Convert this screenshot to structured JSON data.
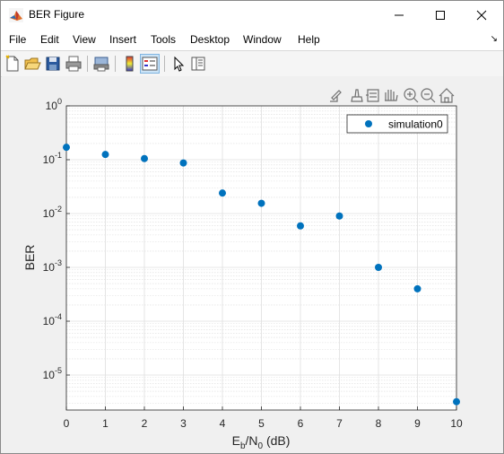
{
  "window": {
    "title": "BER Figure",
    "controls": {
      "minimize": "minimize",
      "maximize": "maximize",
      "close": "close"
    }
  },
  "menu": [
    "File",
    "Edit",
    "View",
    "Insert",
    "Tools",
    "Desktop",
    "Window",
    "Help"
  ],
  "toolbar": {
    "buttons": [
      "new-figure-icon",
      "open-file-icon",
      "save-icon",
      "print-icon",
      "print-preview-icon",
      "colorbar-icon",
      "legend-icon",
      "pointer-icon",
      "property-inspector-icon"
    ],
    "selected": "legend-icon"
  },
  "axes_toolbar": [
    "export-icon",
    "brush-icon",
    "datatip-icon",
    "pan-icon",
    "zoom-in-icon",
    "zoom-out-icon",
    "home-icon"
  ],
  "chart_data": {
    "type": "scatter",
    "xlabel": "E_b/N_0 (dB)",
    "ylabel": "BER",
    "x_ticks": [
      0,
      1,
      2,
      3,
      4,
      5,
      6,
      7,
      8,
      9,
      10
    ],
    "y_ticks": [
      0,
      -1,
      -2,
      -3,
      -4,
      -5
    ],
    "xlim": [
      0,
      10
    ],
    "ylim_log10": [
      -5.65,
      0
    ],
    "yscale": "log",
    "grid": "on (major and minor)",
    "legend_position": "top-right",
    "series": [
      {
        "name": "simulation0",
        "color": "#0072bd",
        "x": [
          0,
          1,
          2,
          3,
          4,
          5,
          6,
          7,
          8,
          9,
          10
        ],
        "y": [
          0.17,
          0.125,
          0.105,
          0.087,
          0.024,
          0.0155,
          0.0059,
          0.009,
          0.001,
          0.0004,
          3.2e-06
        ]
      }
    ]
  }
}
